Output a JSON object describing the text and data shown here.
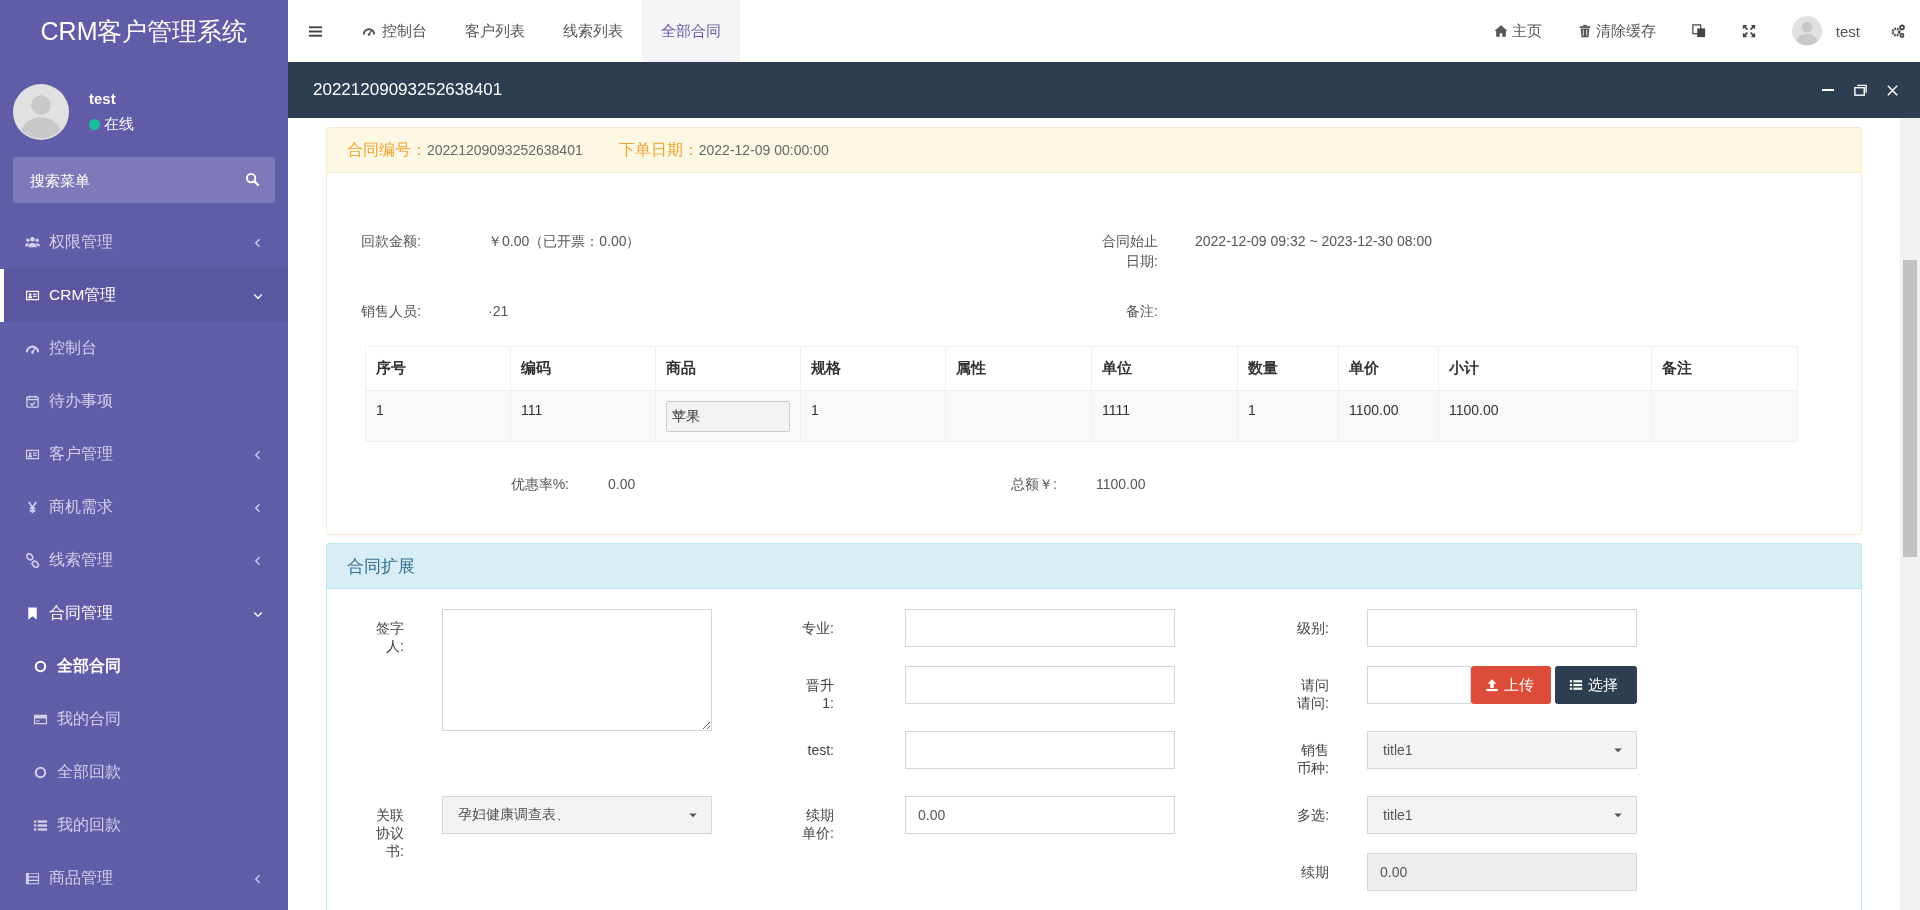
{
  "sidebar": {
    "title": "CRM客户管理系统",
    "user": {
      "name": "test",
      "status": "在线"
    },
    "search": {
      "placeholder": "搜索菜单"
    },
    "menu": [
      {
        "label": "权限管理",
        "expanded": false,
        "selected": false
      },
      {
        "label": "CRM管理",
        "expanded": true,
        "selected": false,
        "children": [
          {
            "label": "控制台",
            "selected": false
          },
          {
            "label": "待办事项",
            "selected": false
          },
          {
            "label": "客户管理",
            "expanded": false,
            "selected": false
          },
          {
            "label": "商机需求",
            "expanded": false,
            "selected": false
          },
          {
            "label": "线索管理",
            "expanded": false,
            "selected": false
          },
          {
            "label": "合同管理",
            "expanded": true,
            "selected": false,
            "children": [
              {
                "label": "全部合同",
                "selected": true
              },
              {
                "label": "我的合同",
                "selected": false
              },
              {
                "label": "全部回款",
                "selected": false
              },
              {
                "label": "我的回款",
                "selected": false
              }
            ]
          },
          {
            "label": "商品管理",
            "expanded": false,
            "selected": false
          }
        ]
      }
    ]
  },
  "header": {
    "tabs": [
      {
        "label": "控制台",
        "selected": false
      },
      {
        "label": "客户列表",
        "selected": false
      },
      {
        "label": "线索列表",
        "selected": false
      },
      {
        "label": "全部合同",
        "selected": true
      }
    ],
    "links": [
      {
        "label": "主页"
      },
      {
        "label": "清除缓存"
      }
    ],
    "user": {
      "name": "test"
    }
  },
  "dialog": {
    "title": "20221209093252638401",
    "contract": {
      "header": [
        {
          "label": "合同编号：",
          "value": "20221209093252638401"
        },
        {
          "label": "下单日期：",
          "value": "2022-12-09 00:00:00"
        }
      ],
      "info": [
        {
          "label": "回款金额:",
          "value": "￥0.00（已开票：0.00）"
        },
        {
          "label": "合同始止日期:",
          "value": "2022-12-09 09:32 ~ 2023-12-30 08:00"
        },
        {
          "label": "销售人员:",
          "value": "·21"
        },
        {
          "label": "备注:"
        }
      ],
      "table": {
        "columns": [
          "序号",
          "编码",
          "商品",
          "规格",
          "属性",
          "单位",
          "数量",
          "单价",
          "小计",
          "备注"
        ],
        "rows": [
          {
            "no": "1",
            "code": "111",
            "goods": "苹果",
            "spec": "1",
            "unit": "1111",
            "qty": "1",
            "price": "1100.00",
            "subtotal": "1100.00"
          }
        ]
      },
      "totals": [
        {
          "label": "优惠率%:",
          "value": "0.00"
        },
        {
          "label": "总额￥:",
          "value": "1100.00"
        }
      ]
    },
    "extension": {
      "title": "合同扩展",
      "columns": [
        {
          "fields": [
            {
              "kind": "textarea",
              "label": "签字人:"
            },
            {
              "kind": "select",
              "label": "关联协议书:",
              "value": "孕妇健康调查表、"
            }
          ]
        },
        {
          "fields": [
            {
              "kind": "input",
              "label": "专业:"
            },
            {
              "kind": "input",
              "label": "晋升1:"
            },
            {
              "kind": "input",
              "label": "test:"
            },
            {
              "kind": "input",
              "label": "续期单价:",
              "value": "0.00"
            }
          ]
        },
        {
          "fields": [
            {
              "kind": "input",
              "label": "级别:"
            },
            {
              "kind": "upload",
              "label": "请问请问:",
              "buttons": [
                "上传",
                "选择"
              ]
            },
            {
              "kind": "select",
              "label": "销售币种:",
              "value": "title1"
            },
            {
              "kind": "select",
              "label": "多选:",
              "value": "title1"
            },
            {
              "kind": "readonly",
              "label": "续期",
              "value": "0.00"
            }
          ]
        }
      ]
    }
  }
}
